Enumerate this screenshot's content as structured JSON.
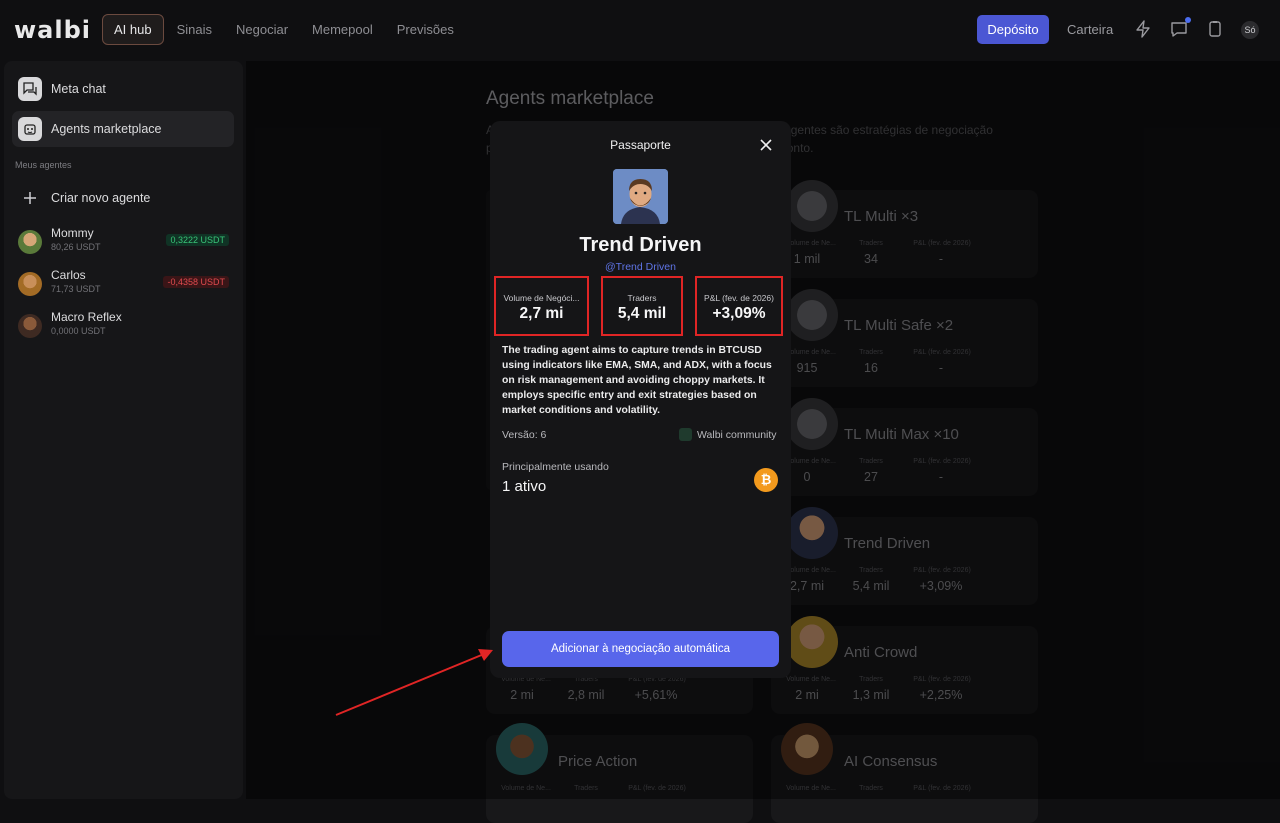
{
  "topbar": {
    "logo": "walbi",
    "nav": [
      "AI hub",
      "Sinais",
      "Negociar",
      "Memepool",
      "Previsões"
    ],
    "deposit_label": "Depósito",
    "wallet_label": "Carteira",
    "avatar_initials": "Só"
  },
  "sidebar": {
    "items": [
      {
        "label": "Meta chat"
      },
      {
        "label": "Agents marketplace"
      }
    ],
    "section_label": "Meus agentes",
    "create_label": "Criar novo agente",
    "agents": [
      {
        "name": "Mommy",
        "balance": "80,26 USDT",
        "pnl": "0,3222 USDT",
        "pnl_state": "positive"
      },
      {
        "name": "Carlos",
        "balance": "71,73 USDT",
        "pnl": "-0,4358 USDT",
        "pnl_state": "negative"
      },
      {
        "name": "Macro Reflex",
        "balance": "0,0000 USDT",
        "pnl": "",
        "pnl_state": "none"
      }
    ]
  },
  "marketplace": {
    "title": "Agents marketplace",
    "desc_line1": "A                                                                               ado. Agentes são estratégias de negociação",
    "desc_line2": "p                                                                               nte pronto.",
    "labels": {
      "volume": "Volume de Ne...",
      "traders": "Traders",
      "pnl": "P&L (fev. de 2026)"
    },
    "cards": [
      {
        "name": "TL Multi ×3",
        "volume": "1 mil",
        "traders": "34",
        "pnl": "-"
      },
      {
        "name": "TL Multi Safe ×2",
        "volume": "915",
        "traders": "16",
        "pnl": "-"
      },
      {
        "name": "TL Multi Max ×10",
        "volume": "0",
        "traders": "27",
        "pnl": "-"
      },
      {
        "name": "Trend Driven",
        "volume": "2,7 mi",
        "traders": "5,4 mil",
        "pnl": "+3,09%"
      },
      {
        "name": "Anti Crowd",
        "volume": "2 mi",
        "traders": "1,3 mil",
        "pnl": "+2,25%"
      },
      {
        "name": "AI Consensus",
        "volume": "",
        "traders": "",
        "pnl": ""
      }
    ],
    "left_cards": [
      {
        "name": "",
        "volume": "2 mi",
        "traders": "2,8 mil",
        "pnl": "+5,61%"
      },
      {
        "name": "Price Action",
        "volume": "",
        "traders": "",
        "pnl": ""
      }
    ]
  },
  "modal": {
    "title": "Passaporte",
    "name": "Trend Driven",
    "handle": "@Trend Driven",
    "stats": [
      {
        "label": "Volume de Negóci...",
        "value": "2,7 mi"
      },
      {
        "label": "Traders",
        "value": "5,4 mil"
      },
      {
        "label": "P&L (fev. de 2026)",
        "value": "+3,09%"
      }
    ],
    "description": "The trading agent aims to capture trends in BTCUSD using indicators like EMA, SMA, and ADX, with a focus on risk management and avoiding choppy markets. It employs specific entry and exit strategies based on market conditions and volatility.",
    "version": "Versão: 6",
    "community": "Walbi community",
    "mainly_using_label": "Principalmente usando",
    "mainly_using_value": "1 ativo",
    "asset_symbol": "₿",
    "add_button": "Adicionar à negociação automática"
  },
  "colors": {
    "accent": "#4b57d4",
    "button": "#5866eb",
    "highlight": "#e02525",
    "handle": "#5f74e6"
  }
}
